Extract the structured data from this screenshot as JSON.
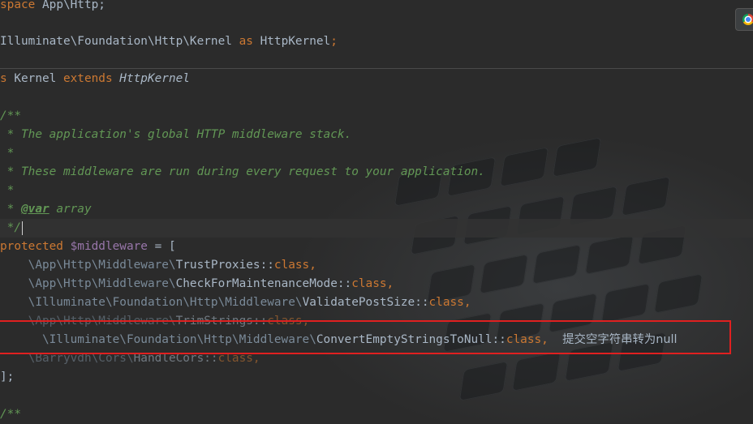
{
  "code": {
    "l1": {
      "kw": "space",
      "rest": " App\\Http;"
    },
    "l2": {
      "path": "Illuminate\\Foundation\\Http\\Kernel",
      "as": " as ",
      "alias": "HttpKernel",
      "semi": ";"
    },
    "l3": {
      "s": "s",
      "name": " Kernel ",
      "extends": "extends",
      "parent": " HttpKernel"
    },
    "l4": {
      "text": "/**"
    },
    "l5": {
      "text": " * The application's global HTTP middleware stack."
    },
    "l6": {
      "text": " *"
    },
    "l7": {
      "text": " * These middleware are run during every request to your application."
    },
    "l8": {
      "text": " *"
    },
    "l9": {
      "star": " * ",
      "tag": "@var",
      "type": " array"
    },
    "l10": {
      "text": " */"
    },
    "l11": {
      "kw": "protected",
      "var": " $middleware",
      "rest": " = ["
    },
    "l12": {
      "ns": "    \\App\\Http\\Middleware\\",
      "cls": "TrustProxies",
      "sep": "::",
      "kw": "class",
      "end": ","
    },
    "l13": {
      "ns": "    \\App\\Http\\Middleware\\",
      "cls": "CheckForMaintenanceMode",
      "sep": "::",
      "kw": "class",
      "end": ","
    },
    "l14": {
      "ns": "    \\Illuminate\\Foundation\\Http\\Middleware\\",
      "cls": "ValidatePostSize",
      "sep": "::",
      "kw": "class",
      "end": ","
    },
    "l15": {
      "ns": "    \\App\\Http\\Middleware\\",
      "cls": "TrimStrings",
      "sep": "::",
      "kw": "class",
      "end": ","
    },
    "l16": {
      "ns": "      \\Illuminate\\Foundation\\Http\\Middleware\\",
      "cls": "ConvertEmptyStringsToNull",
      "sep": "::",
      "kw": "class",
      "end": ",  "
    },
    "l17": {
      "ns": "    \\Barryvdh\\Cors\\",
      "cls": "HandleCors",
      "sep": "::",
      "kw": "class",
      "end": ","
    },
    "l18": {
      "text": "];"
    },
    "l19": {
      "text": "/**"
    }
  },
  "annotation": "提交空字符串转为null",
  "browser_icon": "chrome-icon",
  "colors": {
    "keyword": "#cc7832",
    "doc": "#629755",
    "variable": "#9876aa",
    "text": "#a9b7c6",
    "highlight": "#e02020"
  }
}
